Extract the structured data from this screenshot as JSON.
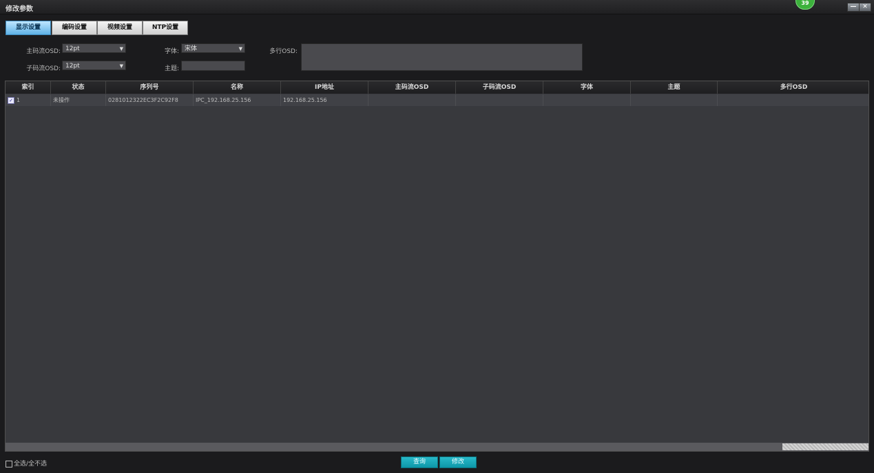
{
  "window": {
    "title": "修改参数",
    "badge": "39",
    "minimize_label": "—",
    "close_label": "✕"
  },
  "tabs": [
    {
      "label": "显示设置",
      "active": true
    },
    {
      "label": "编码设置",
      "active": false
    },
    {
      "label": "视频设置",
      "active": false
    },
    {
      "label": "NTP设置",
      "active": false
    }
  ],
  "form": {
    "main_osd_label": "主码流OSD:",
    "main_osd_value": "12pt",
    "sub_osd_label": "子码流OSD:",
    "sub_osd_value": "12pt",
    "font_label": "字体:",
    "font_value": "宋体",
    "subject_label": "主题:",
    "subject_value": "",
    "multiline_osd_label": "多行OSD:",
    "multiline_osd_value": ""
  },
  "table": {
    "columns": [
      "索引",
      "状态",
      "序列号",
      "名称",
      "IP地址",
      "主码流OSD",
      "子码流OSD",
      "字体",
      "主题",
      "多行OSD"
    ],
    "rows": [
      {
        "checked": true,
        "index": "1",
        "status": "未操作",
        "serial": "0281012322EC3F2C92F8",
        "name": "IPC_192.168.25.156",
        "ip": "192.168.25.156",
        "main_osd": "",
        "sub_osd": "",
        "font": "",
        "subject": "",
        "multiline_osd": ""
      }
    ]
  },
  "footer": {
    "select_all_label": "全选/全不选",
    "query_button": "查询",
    "modify_button": "修改"
  },
  "colors": {
    "accent": "#0d97a8",
    "active_tab": "#5fb2e6",
    "background": "#1b1b1d",
    "table_bg": "#38393d",
    "badge": "#3cb13c"
  }
}
